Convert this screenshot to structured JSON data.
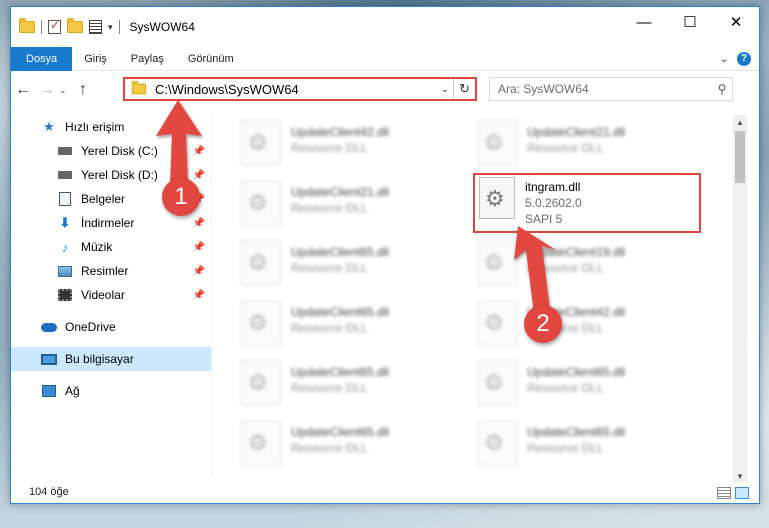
{
  "window": {
    "title": "SysWOW64",
    "controls": {
      "minimize": "—",
      "maximize": "☐",
      "close": "✕"
    }
  },
  "ribbon": {
    "tabs": [
      "Dosya",
      "Giriş",
      "Paylaş",
      "Görünüm"
    ]
  },
  "nav": {
    "address": "C:\\Windows\\SysWOW64",
    "search_placeholder": "Ara: SysWOW64"
  },
  "sidebar": {
    "quick_access": "Hızlı erişim",
    "items": [
      {
        "label": "Yerel Disk (C:)",
        "icon": "drive-icon",
        "pinned": true
      },
      {
        "label": "Yerel Disk (D:)",
        "icon": "drive-icon",
        "pinned": true
      },
      {
        "label": "Belgeler",
        "icon": "documents-icon",
        "pinned": true
      },
      {
        "label": "İndirmeler",
        "icon": "downloads-icon",
        "pinned": true
      },
      {
        "label": "Müzik",
        "icon": "music-icon",
        "pinned": true
      },
      {
        "label": "Resimler",
        "icon": "pictures-icon",
        "pinned": true
      },
      {
        "label": "Videolar",
        "icon": "videos-icon",
        "pinned": true
      }
    ],
    "onedrive": "OneDrive",
    "this_pc": "Bu bilgisayar",
    "network": "Ağ"
  },
  "files": [
    {
      "name": "UpdateClient42.dll",
      "sub": "Resource DLL"
    },
    {
      "name": "UpdateClient21.dll",
      "sub": "Resource DLL"
    },
    {
      "name": "UpdateClient21.dll",
      "sub": "Resource DLL"
    },
    {
      "name": "UpdateClient65.dll",
      "sub": "Resource DLL"
    },
    {
      "name": "UpdateClient19.dll",
      "sub": "Resource DLL"
    },
    {
      "name": "UpdateClient65.dll",
      "sub": "Resource DLL"
    },
    {
      "name": "UpdateClient42.dll",
      "sub": "Resource DLL"
    },
    {
      "name": "UpdateClient65.dll",
      "sub": "Resource DLL"
    },
    {
      "name": "UpdateClient65.dll",
      "sub": "Resource DLL"
    },
    {
      "name": "UpdateClient65.dll",
      "sub": "Resource DLL"
    },
    {
      "name": "UpdateClient65.dll",
      "sub": "Resource DLL"
    }
  ],
  "highlighted_file": {
    "name": "itngram.dll",
    "version": "5.0.2602.0",
    "description": "SAPI 5"
  },
  "status": {
    "count": "104 öğe"
  },
  "annotations": {
    "badge1": "1",
    "badge2": "2",
    "color": "#e2463f"
  }
}
